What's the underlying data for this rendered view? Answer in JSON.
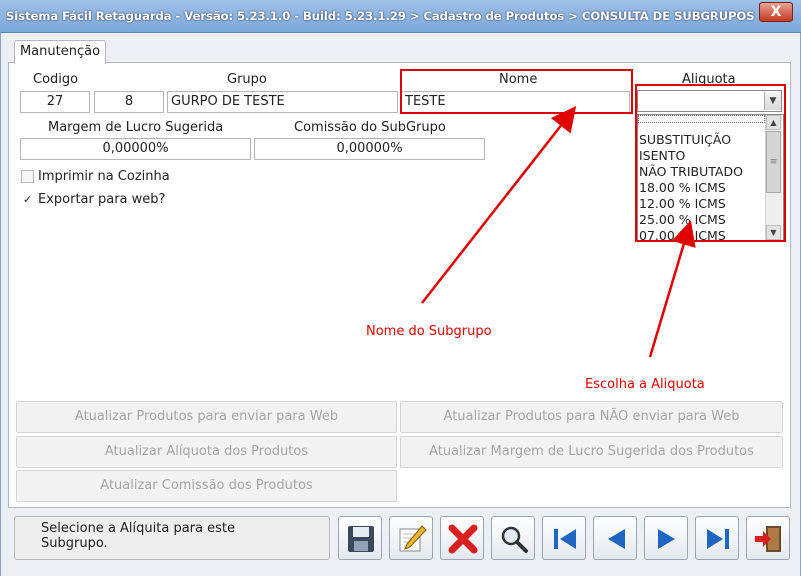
{
  "window": {
    "title": "Sistema Fácil Retaguarda - Versão: 5.23.1.0  - Build: 5.23.1.29 > Cadastro de Produtos > CONSULTA DE SUBGRUPOS > Cadastro de Su...",
    "close_label": "X"
  },
  "tabs": [
    {
      "label": "Manutenção"
    }
  ],
  "form": {
    "codigo_label": "Codigo",
    "codigo_value": "27",
    "grupo_label": "Grupo",
    "grupo_code": "8",
    "grupo_name": "GURPO DE TESTE",
    "nome_label": "Nome",
    "nome_value": "TESTE",
    "aliquota_label": "Aliquota",
    "aliquota_value": "",
    "margem_label": "Margem de Lucro Sugerida",
    "margem_value": "0,00000%",
    "comissao_label": "Comissão do SubGrupo",
    "comissao_value": "0,00000%",
    "imprimir_label": "Imprimir na Cozinha",
    "imprimir_checked": false,
    "exportar_label": "Exportar para web?",
    "exportar_checked": true
  },
  "aliquota_options": [
    "",
    "SUBSTITUIÇÃO",
    "ISENTO",
    "NÃO TRIBUTADO",
    "18.00 % ICMS",
    "12.00 % ICMS",
    "25.00 % ICMS",
    "07.00 % ICMS"
  ],
  "annotations": {
    "nome": "Nome do Subgrupo",
    "aliquota": "Escolha a Aliquota",
    "color": "#e00000"
  },
  "actions": {
    "web_send": "Atualizar Produtos para enviar para Web",
    "web_no_send": "Atualizar Produtos para NÃO enviar para Web",
    "aliquota": "Atualizar Alíquota dos Produtos",
    "margem": "Atualizar Margem de Lucro Sugerida dos Produtos",
    "comissao": "Atualizar Comissão dos Produtos"
  },
  "status": {
    "message": "Selecione a Alíquita para este Subgrupo."
  },
  "toolbar": {
    "icons": [
      "save-icon",
      "edit-icon",
      "delete-icon",
      "search-icon",
      "first-icon",
      "previous-icon",
      "next-icon",
      "last-icon",
      "exit-icon"
    ]
  },
  "colors": {
    "accent": "#1f66c2",
    "danger": "#d92020",
    "titlebar": "#7aa7d8"
  }
}
